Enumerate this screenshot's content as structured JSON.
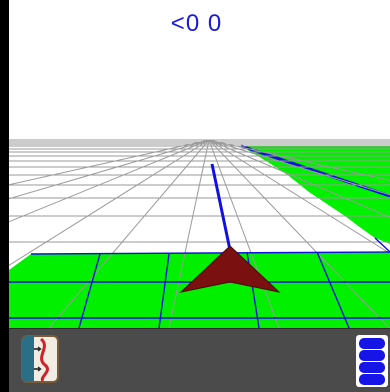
{
  "display": {
    "heading_text": "<0 0"
  },
  "colors": {
    "sky": "#ffffff",
    "ground": "#ffffff",
    "grid_line": "#9a9a9a",
    "coverage": "#00f000",
    "coverage_line": "#1010e0",
    "guidance_line": "#1010e0",
    "vehicle": "#7a1010",
    "heading_text": "#1a1adc",
    "toolbar": "#4b4b4b"
  },
  "toolbar": {
    "left_button_icon": "guidance-icon",
    "right_button_icon": "layers-icon"
  }
}
